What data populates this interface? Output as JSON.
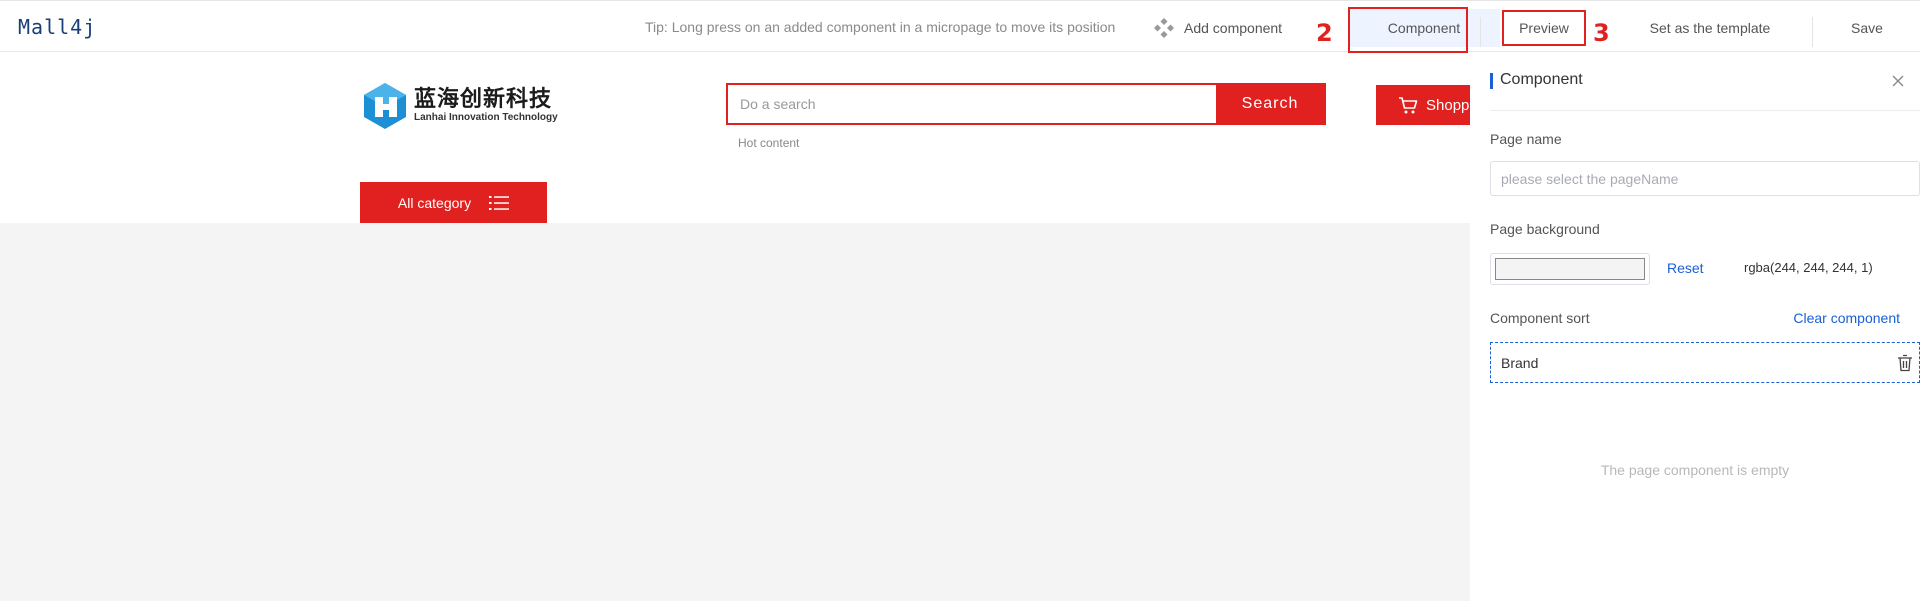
{
  "app": {
    "logo_text": "Mall4j"
  },
  "toolbar": {
    "tip": "Tip: Long press on an added component in a micropage to move its position",
    "add_component": "Add component",
    "component": "Component",
    "preview": "Preview",
    "set_template": "Set as the template",
    "save": "Save",
    "marker_2": "2",
    "marker_3": "3"
  },
  "preview": {
    "brand_cn": "蓝海创新科技",
    "brand_en": "Lanhai Innovation Technology",
    "search_placeholder": "Do a search",
    "search_button": "Search",
    "hot_content": "Hot content",
    "cart_label": "Shopping",
    "all_category": "All category"
  },
  "panel": {
    "title": "Component",
    "page_name_label": "Page name",
    "page_name_placeholder": "please select the pageName",
    "page_background_label": "Page background",
    "reset": "Reset",
    "background_value": "rgba(244, 244, 244, 1)",
    "component_sort_label": "Component sort",
    "clear_component": "Clear component",
    "components": [
      "Brand"
    ],
    "empty_text": "The page component is empty"
  },
  "colors": {
    "accent_red": "#e0211f",
    "link_blue": "#1a5fd6",
    "canvas_bg": "#f4f4f4"
  },
  "icons": {
    "add_component": "four-diamond-icon",
    "cart": "cart-icon",
    "category": "list-icon",
    "close": "close-icon",
    "delete": "trash-icon"
  }
}
